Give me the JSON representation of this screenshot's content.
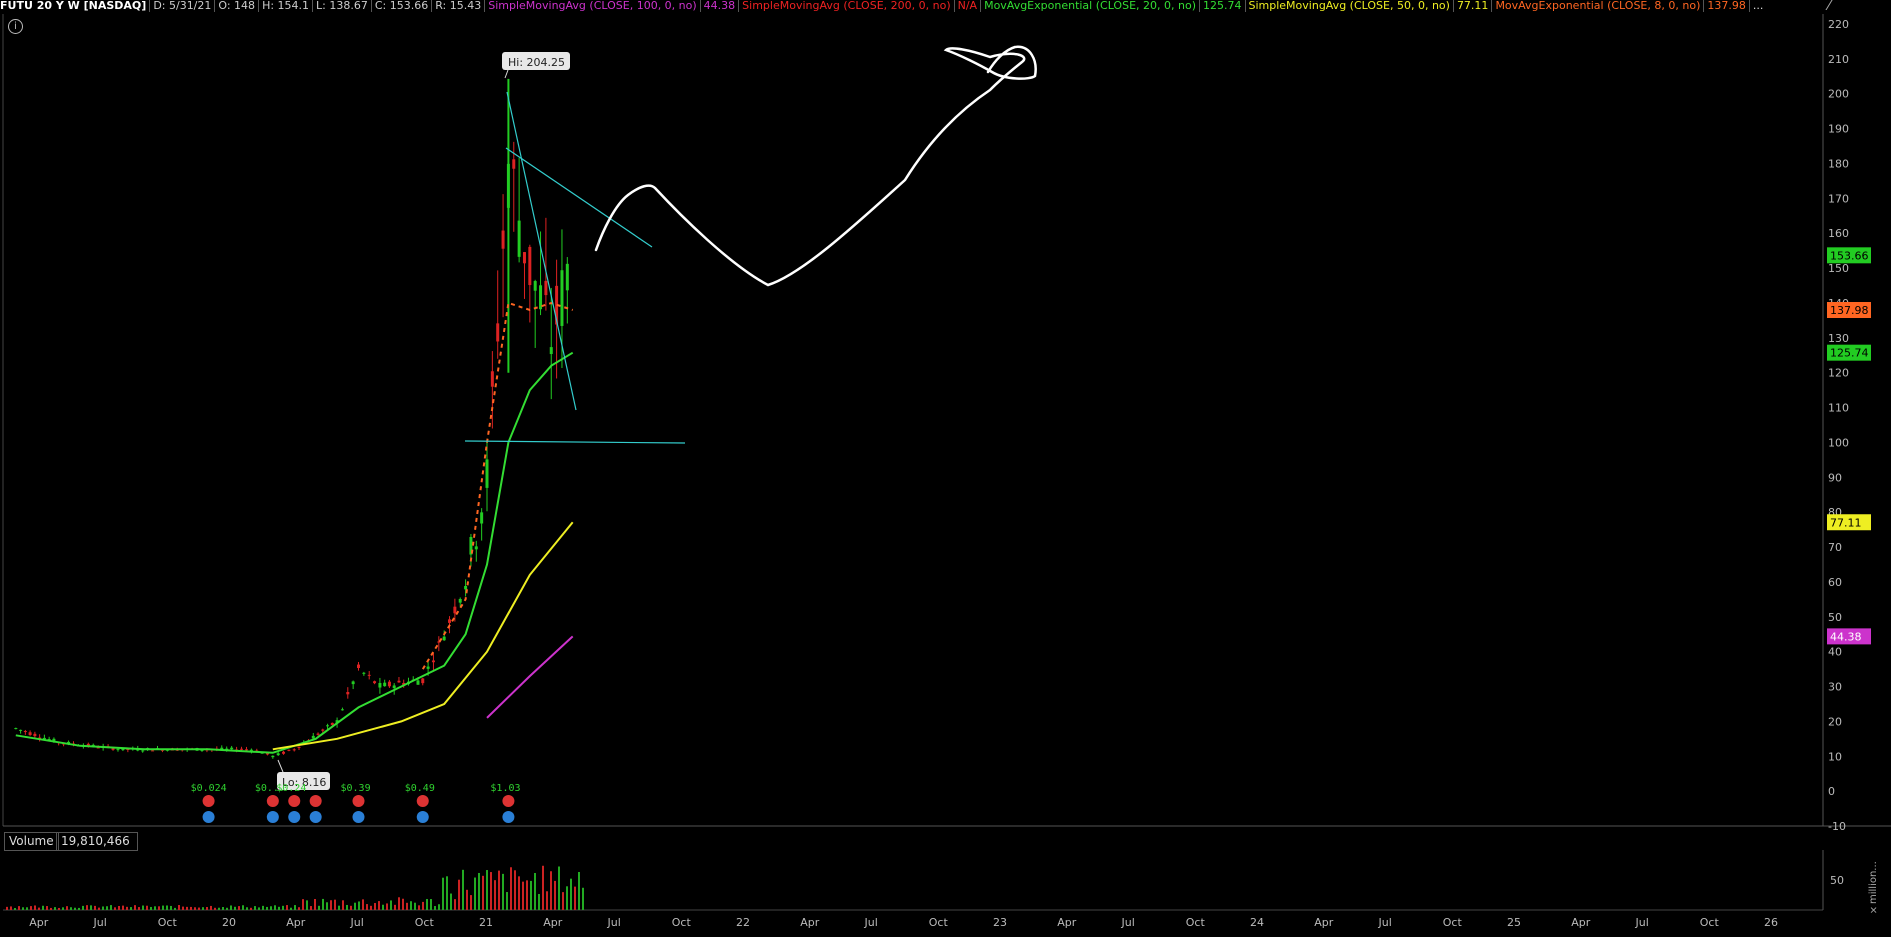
{
  "header": {
    "symbol": "FUTU 20 Y W [NASDAQ]",
    "date": "D: 5/31/21",
    "open": "O: 148",
    "high": "H: 154.1",
    "low": "L: 138.67",
    "close": "C: 153.66",
    "range": "R: 15.43",
    "studies": [
      {
        "label": "SimpleMovingAvg (CLOSE, 100, 0, no)",
        "value": "44.38",
        "color": "#cc33cc"
      },
      {
        "label": "SimpleMovingAvg (CLOSE, 200, 0, no)",
        "value": "N/A",
        "color": "#ee2222"
      },
      {
        "label": "MovAvgExponential (CLOSE, 20, 0, no)",
        "value": "125.74",
        "color": "#33dd33"
      },
      {
        "label": "SimpleMovingAvg (CLOSE, 50, 0, no)",
        "value": "77.11",
        "color": "#eeee22"
      },
      {
        "label": "MovAvgExponential (CLOSE, 8, 0, no)",
        "value": "137.98",
        "color": "#ff6622"
      }
    ],
    "more": "..."
  },
  "icons": {
    "info": "info-icon",
    "corner": "pencil-icon"
  },
  "chart_data": {
    "type": "candlestick",
    "ylim": [
      -10,
      220
    ],
    "y_ticks": [
      -10,
      0,
      10,
      20,
      30,
      40,
      50,
      60,
      70,
      80,
      90,
      100,
      110,
      120,
      130,
      140,
      150,
      160,
      170,
      180,
      190,
      200,
      210,
      220
    ],
    "x_ticks": [
      "Apr",
      "Jul",
      "Oct",
      "20",
      "Apr",
      "Jul",
      "Oct",
      "21",
      "Apr",
      "Jul",
      "Oct",
      "22",
      "Apr",
      "Jul",
      "Oct",
      "23",
      "Apr",
      "Jul",
      "Oct",
      "24",
      "Apr",
      "Jul",
      "Oct",
      "25",
      "Apr",
      "Jul",
      "Oct",
      "26"
    ],
    "price_tags": [
      {
        "value": "153.66",
        "bg": "#22cc22",
        "fg": "#000000",
        "y": 153.66
      },
      {
        "value": "137.98",
        "bg": "#ff6622",
        "fg": "#000000",
        "y": 137.98
      },
      {
        "value": "125.74",
        "bg": "#22cc22",
        "fg": "#000000",
        "y": 125.74
      },
      {
        "value": "77.11",
        "bg": "#eeee22",
        "fg": "#000000",
        "y": 77.11
      },
      {
        "value": "44.38",
        "bg": "#cc33cc",
        "fg": "#ffffff",
        "y": 44.38
      }
    ],
    "callouts": {
      "hi": "Hi: 204.25",
      "lo": "Lo: 8.16"
    },
    "dividends": [
      "$0.024",
      "$0...",
      "$0.24",
      "$0.39",
      "$0.49",
      "$1.03"
    ],
    "series": [
      {
        "name": "MovAvgExponential (CLOSE, 20, 0, no)",
        "color": "#33dd33",
        "x": [
          "2019-03",
          "2019-06",
          "2019-09",
          "2019-12",
          "2020-03",
          "2020-05",
          "2020-07",
          "2020-09",
          "2020-11",
          "2020-12",
          "2021-01",
          "2021-02",
          "2021-03",
          "2021-04",
          "2021-05"
        ],
        "values": [
          16,
          13,
          12,
          12,
          11,
          15,
          24,
          30,
          36,
          45,
          65,
          100,
          115,
          122,
          125.74
        ]
      },
      {
        "name": "SimpleMovingAvg (CLOSE, 50, 0, no)",
        "color": "#eeee22",
        "x": [
          "2020-03",
          "2020-06",
          "2020-09",
          "2020-11",
          "2021-01",
          "2021-03",
          "2021-05"
        ],
        "values": [
          12,
          15,
          20,
          25,
          40,
          62,
          77.11
        ]
      },
      {
        "name": "SimpleMovingAvg (CLOSE, 100, 0, no)",
        "color": "#cc33cc",
        "x": [
          "2021-01",
          "2021-03",
          "2021-05"
        ],
        "values": [
          21,
          33,
          44.38
        ]
      }
    ],
    "volume": {
      "label": "Volume",
      "value": "19,810,466",
      "unit": "×million...",
      "y_tick": "50"
    }
  }
}
